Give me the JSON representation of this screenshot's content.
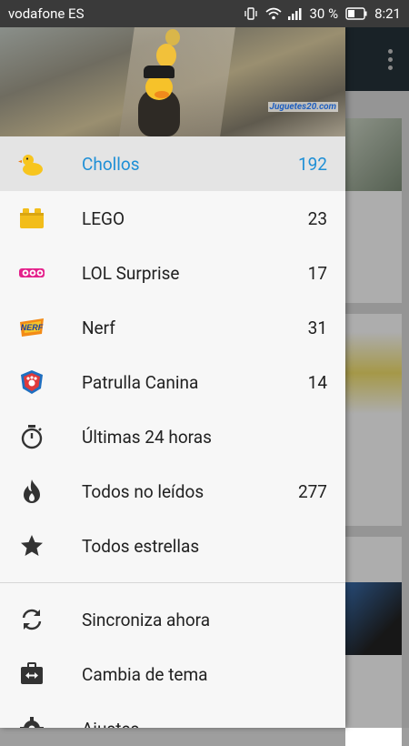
{
  "statusbar": {
    "carrier": "vodafone ES",
    "battery_pct": "30 %",
    "time": "8:21"
  },
  "header": {
    "brand_text": "Juguetes20.com"
  },
  "drawer": {
    "items": [
      {
        "label": "Chollos",
        "count": "192",
        "icon": "duck-icon",
        "active": true
      },
      {
        "label": "LEGO",
        "count": "23",
        "icon": "lego-brick-icon"
      },
      {
        "label": "LOL Surprise",
        "count": "17",
        "icon": "lol-surprise-logo-icon"
      },
      {
        "label": "Nerf",
        "count": "31",
        "icon": "nerf-logo-icon"
      },
      {
        "label": "Patrulla Canina",
        "count": "14",
        "icon": "paw-patrol-logo-icon"
      },
      {
        "label": "Últimas 24 horas",
        "count": "",
        "icon": "stopwatch-icon"
      },
      {
        "label": "Todos no leídos",
        "count": "277",
        "icon": "flame-icon"
      },
      {
        "label": "Todos estrellas",
        "count": "",
        "icon": "star-icon"
      }
    ],
    "actions": [
      {
        "label": "Sincroniza ahora",
        "icon": "sync-icon"
      },
      {
        "label": "Cambia de tema",
        "icon": "theme-switch-icon"
      },
      {
        "label": "Ajustes",
        "icon": "settings-gear-icon"
      }
    ]
  },
  "colors": {
    "accent": "#1e8fd6",
    "toolbar": "#26333a",
    "statusbar": "#3a3a3a"
  }
}
